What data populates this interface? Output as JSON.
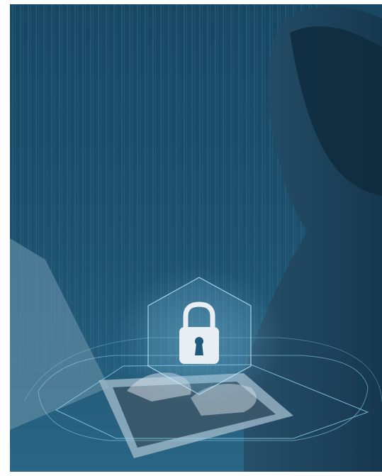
{
  "image": {
    "alt": "",
    "colors": {
      "background": "#ffffff",
      "deep_blue": "#0f3652",
      "mid_blue": "#1f5a7c",
      "highlight": "#8fd6f0",
      "lock": "#e8eef2"
    },
    "icons": [
      "padlock-icon",
      "keyhole-icon"
    ]
  }
}
